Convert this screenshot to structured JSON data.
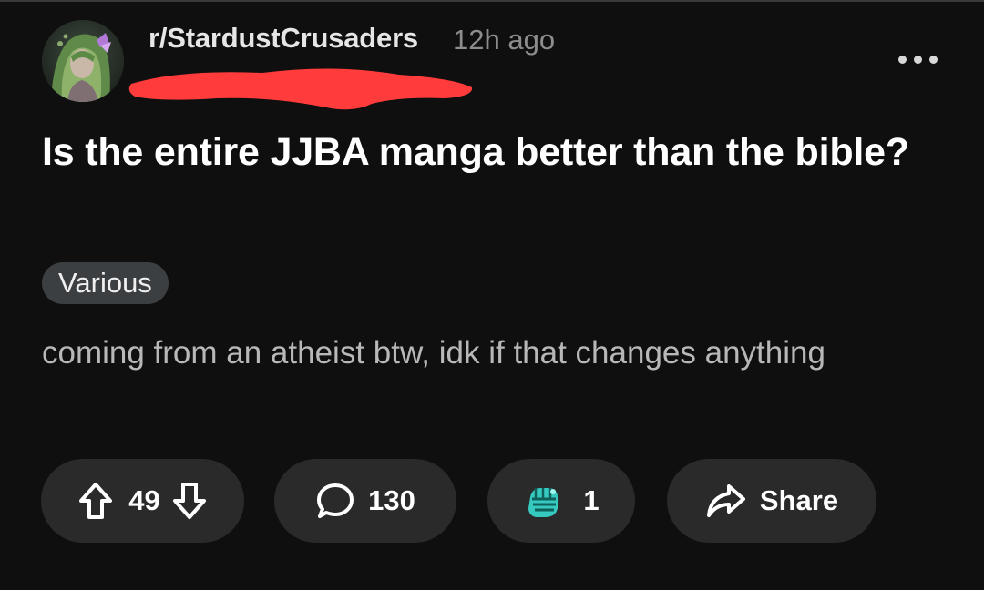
{
  "header": {
    "subreddit": "r/StardustCrusaders",
    "time_ago": "12h ago",
    "menu_icon": "more-horizontal-icon"
  },
  "post": {
    "title": "Is the entire JJBA manga better than the bible?",
    "flair": "Various",
    "body": "coming from an atheist btw, idk if that changes anything"
  },
  "actions": {
    "upvote_icon": "arrow-up-icon",
    "vote_count": "49",
    "downvote_icon": "arrow-down-icon",
    "comment_icon": "comment-bubble-icon",
    "comment_count": "130",
    "award_icon": "award-fist-icon",
    "award_count": "1",
    "share_icon": "share-arrow-icon",
    "share_label": "Share"
  },
  "colors": {
    "background": "#0f0f0f",
    "pill_background": "#2a2a2a",
    "flair_background": "#3b3f42",
    "redaction": "#ff3b3b",
    "muted_text": "#8d8d8d",
    "award_teal": "#35c9c0"
  }
}
